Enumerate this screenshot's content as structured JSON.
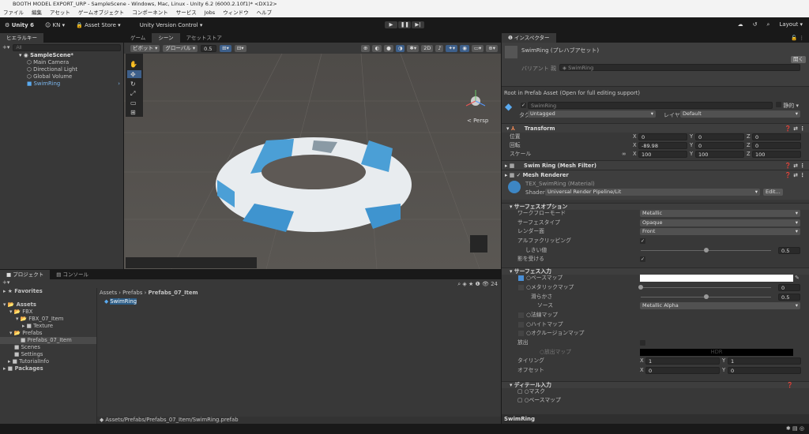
{
  "window": {
    "title": "BOOTH MODEL EXPORT_URP - SampleScene - Windows, Mac, Linux - Unity 6.2 (6000.2.10f1)* <DX12>"
  },
  "menu": [
    "ファイル",
    "編集",
    "アセット",
    "ゲームオブジェクト",
    "コンポーネント",
    "サービス",
    "Jobs",
    "ウィンドウ",
    "ヘルプ"
  ],
  "toolbar": {
    "unity": "Unity 6",
    "account": "KN",
    "asset_store": "Asset Store",
    "version_control": "Unity Version Control",
    "layout": "Layout"
  },
  "hierarchy": {
    "tab": "ヒエラルキー",
    "search_placeholder": "All",
    "scene": "SampleScene*",
    "items": [
      "Main Camera",
      "Directional Light",
      "Global Volume",
      "SwimRing"
    ]
  },
  "scene": {
    "tabs": [
      "ゲーム",
      "シーン",
      "アセットストア"
    ],
    "pivot": "ピボット",
    "global": "グローバル",
    "snap": "0.5",
    "persp": "< Persp"
  },
  "project": {
    "tabs": [
      "プロジェクト",
      "コンソール"
    ],
    "favorites": "Favorites",
    "tree": [
      "Assets",
      "FBX",
      "FBX_07_Item",
      "Texture",
      "Prefabs",
      "Prefabs_07_Item",
      "Scenes",
      "Settings",
      "TutorialInfo",
      "Packages"
    ],
    "breadcrumb": [
      "Assets",
      "Prefabs",
      "Prefabs_07_Item"
    ],
    "file": "SwimRing",
    "path": "Assets/Prefabs/Prefabs_07_Item/SwimRing.prefab",
    "count": "24"
  },
  "inspector": {
    "tab": "インスペクター",
    "title": "SwimRing (プレハブアセット)",
    "open": "開く",
    "variant_label": "バリアント 親",
    "variant_value": "SwimRing",
    "root_note": "Root in Prefab Asset (Open for full editing support)",
    "name": "SwimRing",
    "static": "静的",
    "tag_label": "タグ",
    "tag": "Untagged",
    "layer_label": "レイヤー",
    "layer": "Default",
    "transform": {
      "title": "Transform",
      "rows": [
        {
          "label": "位置",
          "x": "0",
          "y": "0",
          "z": "0"
        },
        {
          "label": "回転",
          "x": "-89.98",
          "y": "0",
          "z": "0"
        },
        {
          "label": "スケール",
          "x": "100",
          "y": "100",
          "z": "100"
        }
      ]
    },
    "mesh_filter": "Swim Ring (Mesh Filter)",
    "mesh_renderer": "Mesh Renderer",
    "material": "TEX_SwimRing (Material)",
    "shader_label": "Shader",
    "shader": "Universal Render Pipeline/Lit",
    "edit": "Edit...",
    "surface_options": {
      "title": "サーフェスオプション",
      "workflow_label": "ワークフローモード",
      "workflow": "Metallic",
      "surface_label": "サーフェスタイプ",
      "surface": "Opaque",
      "render_face_label": "レンダー面",
      "render_face": "Front",
      "alpha_clip": "アルファクリッピング",
      "threshold_label": "しきい値",
      "threshold": "0.5",
      "receive_shadows": "影を受ける"
    },
    "surface_inputs": {
      "title": "サーフェス入力",
      "base_map": "ベースマップ",
      "metallic_map": "メタリックマップ",
      "metallic": "0",
      "smoothness_label": "滑らかさ",
      "smoothness": "0.5",
      "source_label": "ソース",
      "source": "Metallic Alpha",
      "normal_map": "法線マップ",
      "height_map": "ハイトマップ",
      "occlusion_map": "オクルージョンマップ",
      "emission": "放出",
      "emission_map": "放出マップ",
      "hdr": "HDR",
      "tiling_label": "タイリング",
      "tiling_x": "1",
      "tiling_y": "1",
      "offset_label": "オフセット",
      "offset_x": "0",
      "offset_y": "0"
    },
    "detail_inputs": {
      "title": "ディテール入力",
      "mask": "マスク",
      "base_map": "ベースマップ"
    },
    "preview": "SwimRing"
  }
}
